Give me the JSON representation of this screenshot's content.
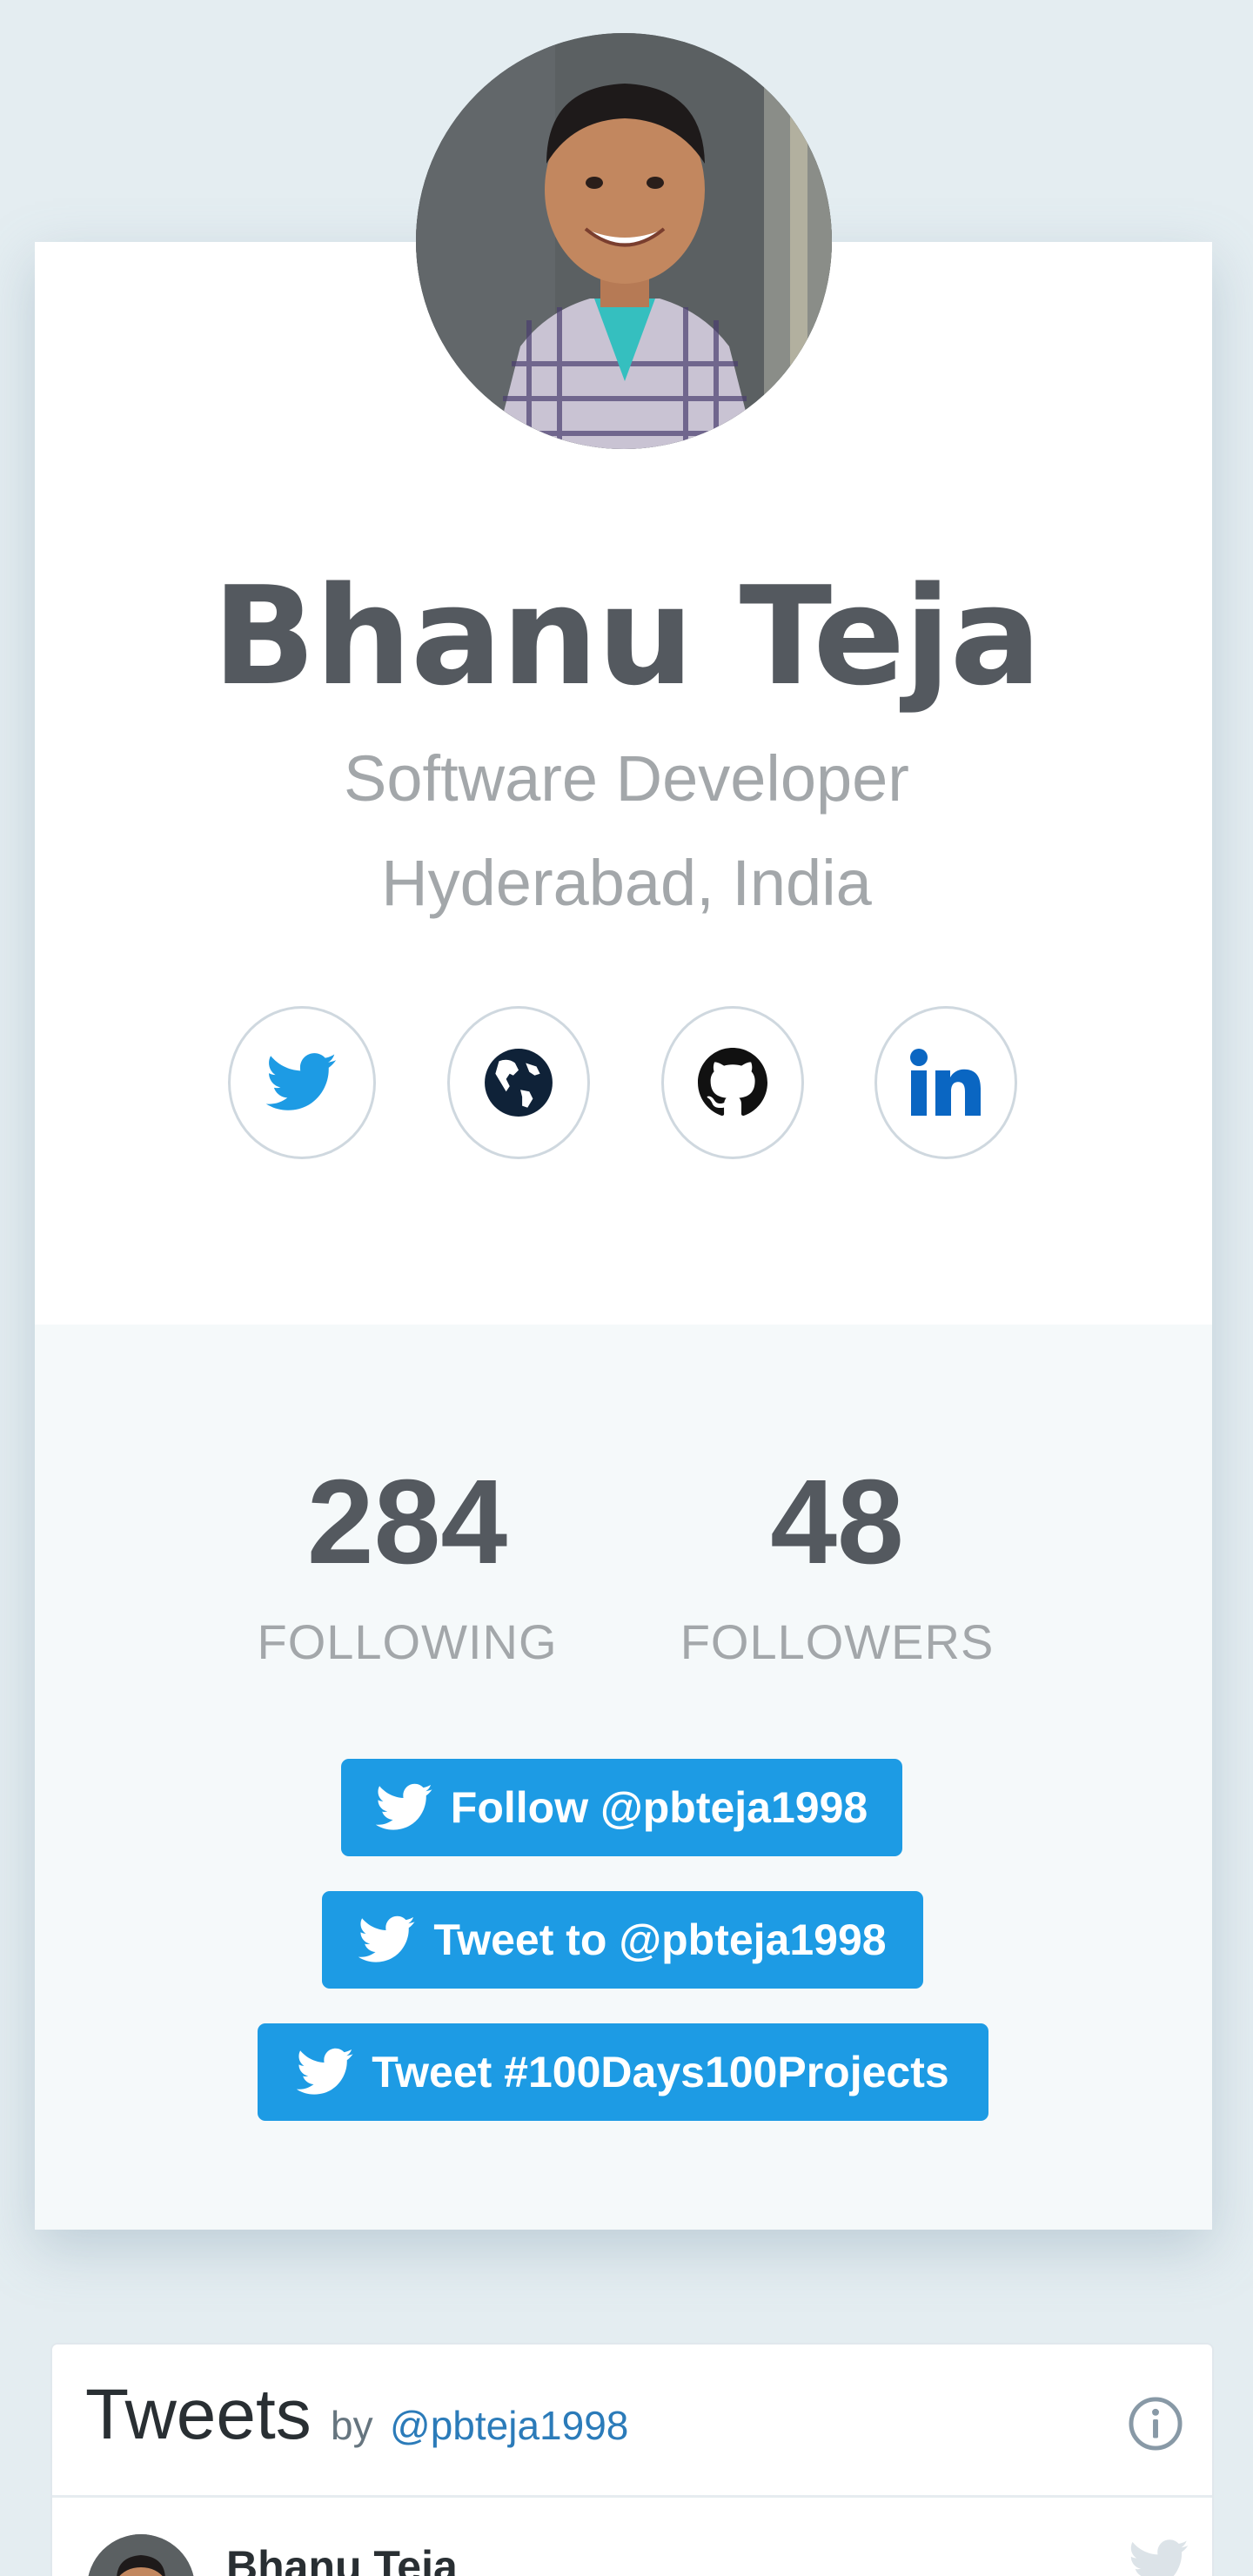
{
  "profile": {
    "name": "Bhanu Teja",
    "role": "Software Developer",
    "location": "Hyderabad, India"
  },
  "social_links": [
    {
      "icon": "twitter-icon",
      "color": "#1d9be4"
    },
    {
      "icon": "globe-icon",
      "color": "#0f2238"
    },
    {
      "icon": "github-icon",
      "color": "#111111"
    },
    {
      "icon": "linkedin-icon",
      "color": "#0a66c2"
    }
  ],
  "stats": {
    "following_count": "284",
    "following_label": "FOLLOWING",
    "followers_count": "48",
    "followers_label": "FOLLOWERS"
  },
  "actions": {
    "follow_label": "Follow @pbteja1998",
    "tweet_to_label": "Tweet to @pbteja1998",
    "hashtag_label": "Tweet #100Days100Projects"
  },
  "timeline": {
    "title": "Tweets",
    "by": "by",
    "handle": "@pbteja1998",
    "first_tweet_author": "Bhanu Teja"
  },
  "colors": {
    "twitter_blue": "#1d9be4",
    "text_dark": "#54595f",
    "text_muted": "#a3a7aa",
    "page_bg": "#e4edf1"
  }
}
